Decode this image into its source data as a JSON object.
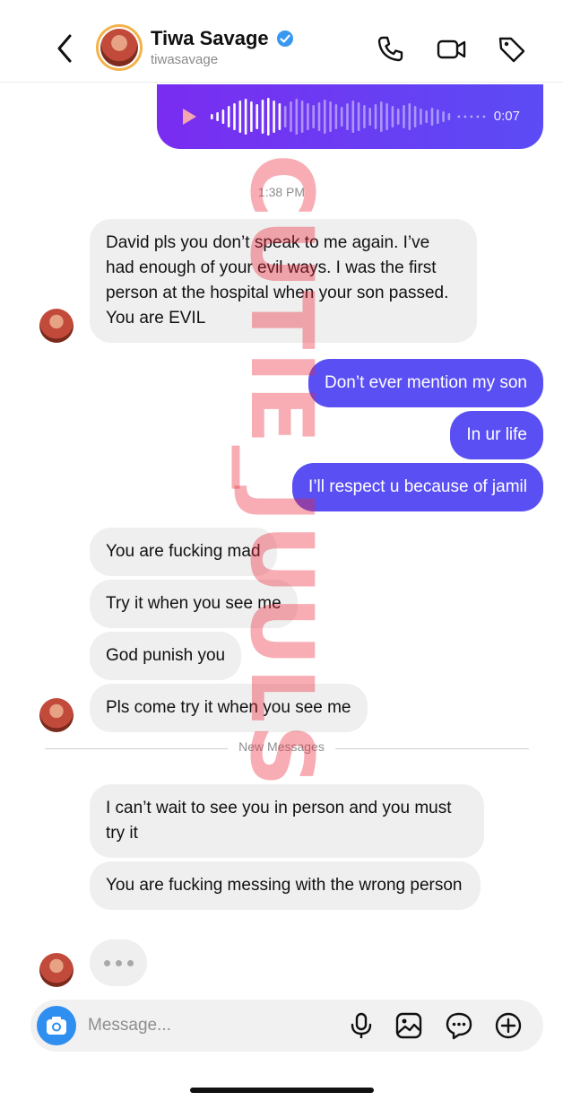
{
  "header": {
    "contact_name": "Tiwa Savage",
    "username": "tiwasavage",
    "verified": true,
    "icons": [
      "back-icon",
      "verified-icon",
      "phone-icon",
      "video-icon",
      "tag-icon"
    ]
  },
  "chat": {
    "voice_message": {
      "duration": "0:07",
      "progress": 0.3
    },
    "timestamp": "1:38 PM",
    "messages": [
      {
        "from": "contact",
        "text": "David pls you don’t speak to me again. I’ve had enough of your evil ways. I was the first person at the hospital when your son passed. You are EVIL"
      },
      {
        "from": "me",
        "text": "Don’t ever mention my son"
      },
      {
        "from": "me",
        "text": "In ur life"
      },
      {
        "from": "me",
        "text": "I’ll respect u because of jamil"
      },
      {
        "from": "contact",
        "text": "You are fucking mad"
      },
      {
        "from": "contact",
        "text": "Try it when you see me"
      },
      {
        "from": "contact",
        "text": "God punish you"
      },
      {
        "from": "contact",
        "text": "Pls come try it when you see me"
      },
      {
        "from": "contact",
        "text": "I can’t wait to see you in person and you must try it"
      },
      {
        "from": "contact",
        "text": "You are fucking messing with the wrong person"
      }
    ],
    "new_messages_label": "New Messages"
  },
  "composer": {
    "placeholder": "Message...",
    "icons": [
      "camera-icon",
      "microphone-icon",
      "gallery-icon",
      "sticker-icon",
      "add-icon"
    ]
  },
  "watermark": "CUTIE_JUULS",
  "colors": {
    "outgoing_bubble": "#5a4ff3",
    "incoming_bubble": "#efefef",
    "camera_button": "#2f8ff0",
    "watermark": "#eb2837"
  }
}
